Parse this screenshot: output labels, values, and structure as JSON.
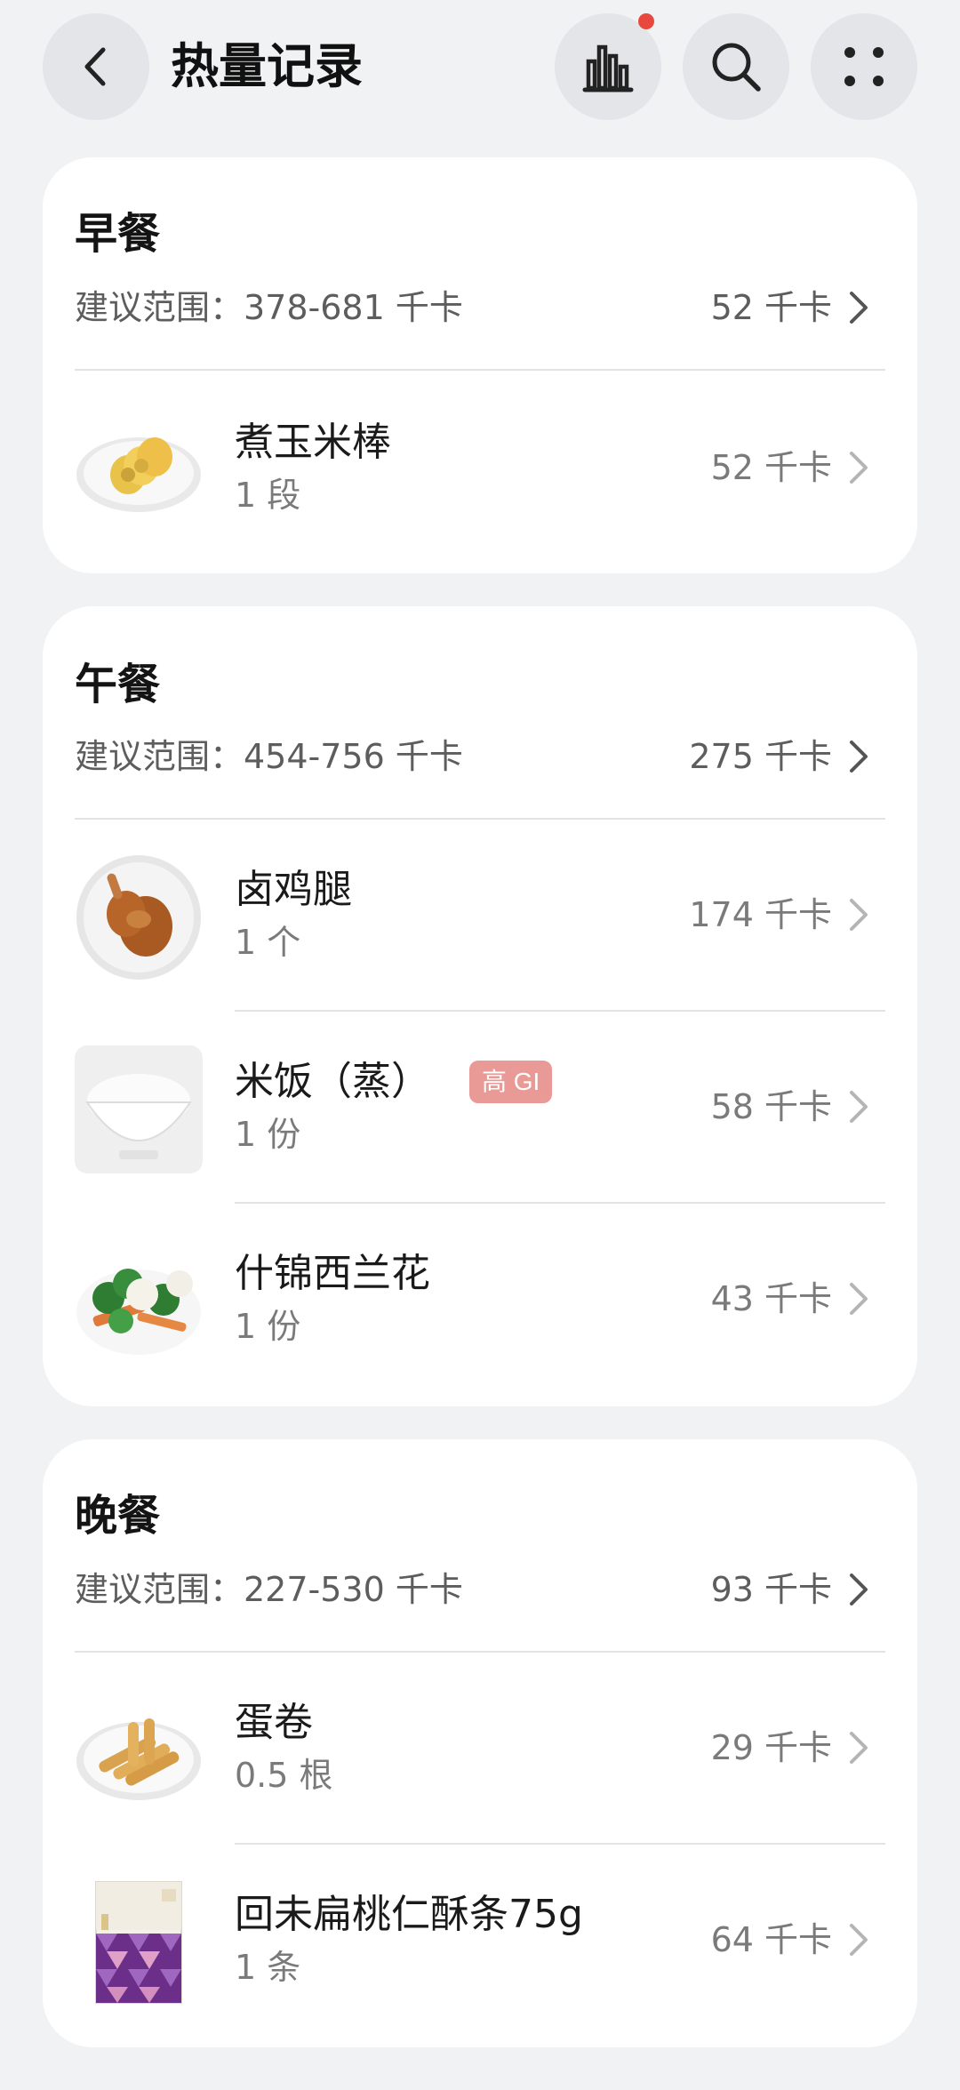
{
  "header": {
    "title": "热量记录",
    "accent_dot_color": "#e8493e"
  },
  "meals": [
    {
      "title": "早餐",
      "range": "建议范围：378-681 千卡",
      "kcal": "52 千卡",
      "items": [
        {
          "name": "煮玉米棒",
          "qty": "1 段",
          "kcal": "52 千卡",
          "icon": "corn-plate-image"
        }
      ]
    },
    {
      "title": "午餐",
      "range": "建议范围：454-756 千卡",
      "kcal": "275 千卡",
      "items": [
        {
          "name": "卤鸡腿",
          "qty": "1 个",
          "kcal": "174 千卡",
          "icon": "chicken-leg-image"
        },
        {
          "name": "米饭（蒸）",
          "qty": "1 份",
          "kcal": "58 千卡",
          "badge": "高 GI",
          "icon": "rice-bowl-image"
        },
        {
          "name": "什锦西兰花",
          "qty": "1 份",
          "kcal": "43 千卡",
          "icon": "broccoli-image"
        }
      ]
    },
    {
      "title": "晚餐",
      "range": "建议范围：227-530 千卡",
      "kcal": "93 千卡",
      "items": [
        {
          "name": "蛋卷",
          "qty": "0.5 根",
          "kcal": "29 千卡",
          "icon": "egg-roll-image"
        },
        {
          "name": "回未扁桃仁酥条75g",
          "qty": "1 条",
          "kcal": "64 千卡",
          "icon": "snack-package-image"
        }
      ]
    }
  ]
}
